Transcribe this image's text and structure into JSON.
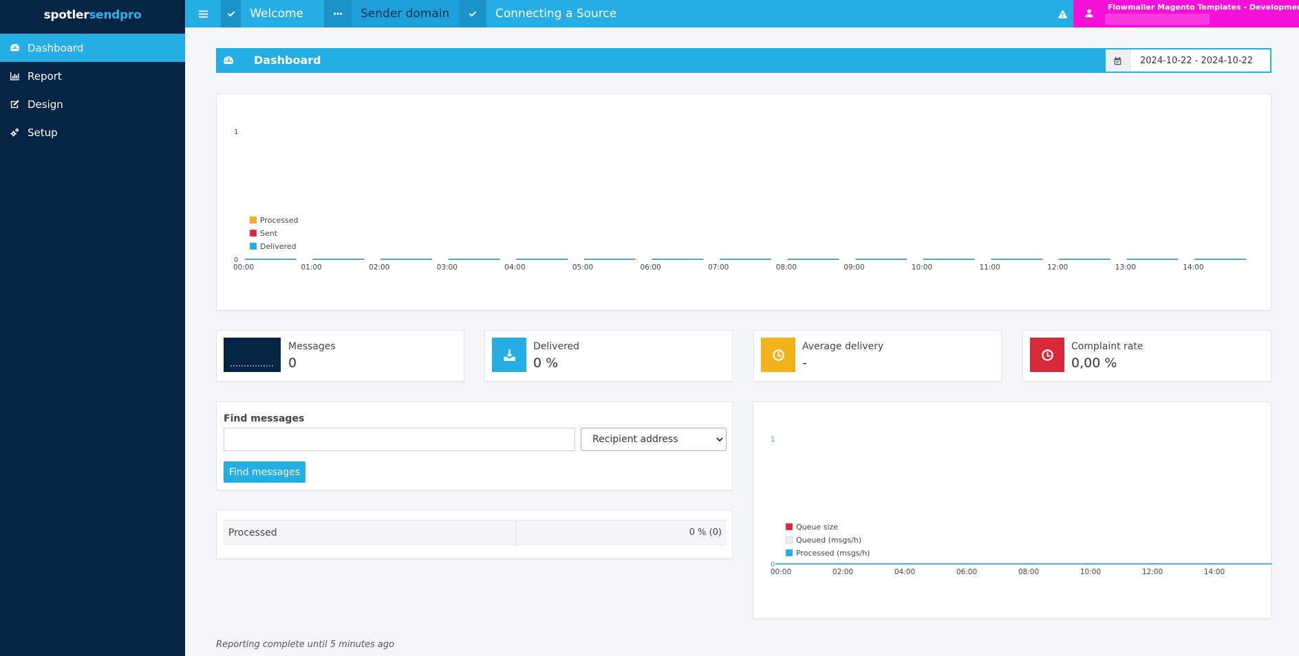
{
  "brand": {
    "part1": "spotler",
    "part2": "sendpro"
  },
  "sidebar": {
    "items": [
      {
        "label": "Dashboard",
        "icon": "dashboard-icon",
        "active": true
      },
      {
        "label": "Report",
        "icon": "bar-chart-icon",
        "active": false
      },
      {
        "label": "Design",
        "icon": "edit-icon",
        "active": false
      },
      {
        "label": "Setup",
        "icon": "gears-icon",
        "active": false
      }
    ]
  },
  "topbar": {
    "tabs": [
      {
        "label": "Welcome",
        "icon": "check-icon"
      },
      {
        "label": "Sender domain",
        "icon": "ellipsis-icon"
      },
      {
        "label": "Connecting a Source",
        "icon": "check-icon"
      }
    ],
    "user_name": "Flowmailer Magento Templates - Development",
    "colors": {
      "bar": "#24aee4",
      "user_area": "#f611d8"
    }
  },
  "dashboard": {
    "title": "Dashboard",
    "date_range": "2024-10-22 - 2024-10-22"
  },
  "chart_data": [
    {
      "type": "line",
      "y_ticks": [
        "1",
        "0"
      ],
      "ylim": [
        0,
        1
      ],
      "x": [
        "00:00",
        "01:00",
        "02:00",
        "03:00",
        "04:00",
        "05:00",
        "06:00",
        "07:00",
        "08:00",
        "09:00",
        "10:00",
        "11:00",
        "12:00",
        "13:00",
        "14:00"
      ],
      "series": [
        {
          "name": "Processed",
          "color": "#f1b21b",
          "values": [
            0,
            0,
            0,
            0,
            0,
            0,
            0,
            0,
            0,
            0,
            0,
            0,
            0,
            0,
            0
          ]
        },
        {
          "name": "Sent",
          "color": "#d8283a",
          "values": [
            0,
            0,
            0,
            0,
            0,
            0,
            0,
            0,
            0,
            0,
            0,
            0,
            0,
            0,
            0
          ]
        },
        {
          "name": "Delivered",
          "color": "#24aee4",
          "values": [
            0,
            0,
            0,
            0,
            0,
            0,
            0,
            0,
            0,
            0,
            0,
            0,
            0,
            0,
            0
          ]
        }
      ],
      "legend": "bottom-left"
    },
    {
      "type": "line",
      "y_ticks": [
        "1",
        "0"
      ],
      "ylim": [
        0,
        1
      ],
      "x": [
        "00:00",
        "02:00",
        "04:00",
        "06:00",
        "08:00",
        "10:00",
        "12:00",
        "14:00"
      ],
      "series": [
        {
          "name": "Queue size",
          "color": "#d8283a",
          "values": [
            0,
            0,
            0,
            0,
            0,
            0,
            0,
            0
          ]
        },
        {
          "name": "Queued (msgs/h)",
          "color": "#e8f0f7",
          "values": [
            0,
            0,
            0,
            0,
            0,
            0,
            0,
            0
          ]
        },
        {
          "name": "Processed (msgs/h)",
          "color": "#24aee4",
          "values": [
            0,
            0,
            0,
            0,
            0,
            0,
            0,
            0
          ]
        }
      ],
      "legend": "bottom-left"
    }
  ],
  "stats": [
    {
      "label": "Messages",
      "value": "0",
      "icon": "sparkline-icon",
      "color": "#062545"
    },
    {
      "label": "Delivered",
      "value": "0 %",
      "icon": "download-icon",
      "color": "#24aee4"
    },
    {
      "label": "Average delivery",
      "value": "-",
      "icon": "clock-icon",
      "color": "#f1b21b"
    },
    {
      "label": "Complaint rate",
      "value": "0,00 %",
      "icon": "clock-icon",
      "color": "#d8283a"
    }
  ],
  "find": {
    "label": "Find messages",
    "input_value": "",
    "select_value": "Recipient address",
    "button_label": "Find messages"
  },
  "processed_row": {
    "label": "Processed",
    "value": "0 % (0)"
  },
  "footer": "Reporting complete until 5 minutes ago"
}
